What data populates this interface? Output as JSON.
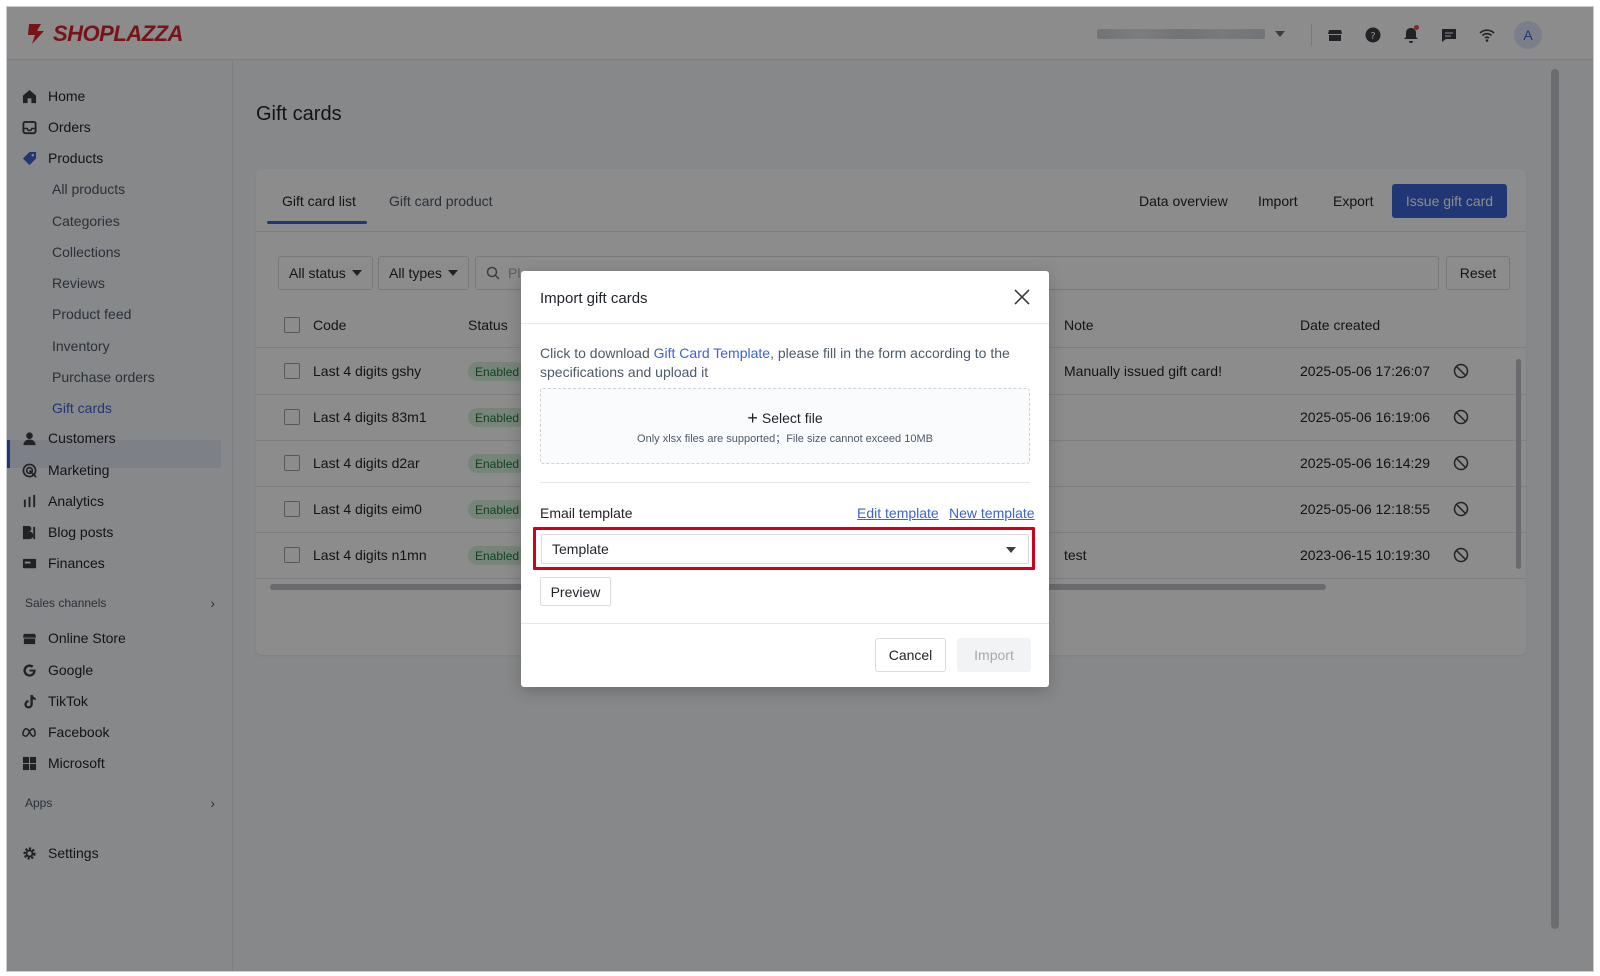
{
  "brand": {
    "name": "SHOPLAZZA",
    "color": "#d8262c"
  },
  "topbar": {
    "avatar_letter": "A",
    "icons": [
      "store-icon",
      "help-icon",
      "bell-icon",
      "message-icon",
      "wifi-icon"
    ]
  },
  "sidebar": {
    "items": [
      {
        "label": "Home",
        "icon": "home-icon"
      },
      {
        "label": "Orders",
        "icon": "orders-icon"
      },
      {
        "label": "Products",
        "icon": "tag-icon"
      },
      {
        "label": "Customers",
        "icon": "person-icon"
      },
      {
        "label": "Marketing",
        "icon": "marketing-icon"
      },
      {
        "label": "Analytics",
        "icon": "bar-chart-icon"
      },
      {
        "label": "Blog posts",
        "icon": "blog-icon"
      },
      {
        "label": "Finances",
        "icon": "finance-icon"
      }
    ],
    "product_subitems": [
      "All products",
      "Categories",
      "Collections",
      "Reviews",
      "Product feed",
      "Inventory",
      "Purchase orders",
      "Gift cards"
    ],
    "sales_channels_label": "Sales channels",
    "channels": [
      {
        "label": "Online Store",
        "icon": "store-icon"
      },
      {
        "label": "Google",
        "icon": "google-icon"
      },
      {
        "label": "TikTok",
        "icon": "tiktok-icon"
      },
      {
        "label": "Facebook",
        "icon": "meta-icon"
      },
      {
        "label": "Microsoft",
        "icon": "microsoft-icon"
      }
    ],
    "apps_label": "Apps",
    "settings_label": "Settings"
  },
  "page": {
    "title": "Gift cards",
    "tabs": [
      "Gift card list",
      "Gift card product"
    ],
    "actions": {
      "data_overview": "Data overview",
      "import": "Import",
      "export": "Export",
      "issue": "Issue gift card"
    },
    "filters": {
      "status": "All status",
      "types": "All types",
      "search_placeholder": "Pl",
      "reset": "Reset"
    },
    "table": {
      "headers": {
        "code": "Code",
        "status": "Status",
        "note": "Note",
        "date_created": "Date created"
      },
      "rows": [
        {
          "code": "Last 4 digits gshy",
          "status": "Enabled",
          "note": "Manually issued gift card!",
          "date": "2025-05-06 17:26:07"
        },
        {
          "code": "Last 4 digits 83m1",
          "status": "Enabled",
          "note": "",
          "date": "2025-05-06 16:19:06"
        },
        {
          "code": "Last 4 digits d2ar",
          "status": "Enabled",
          "note": "",
          "date": "2025-05-06 16:14:29"
        },
        {
          "code": "Last 4 digits eim0",
          "status": "Enabled",
          "note": "",
          "date": "2025-05-06 12:18:55"
        },
        {
          "code": "Last 4 digits n1mn",
          "status": "Enabled",
          "note": "test",
          "date": "2023-06-15 10:19:30"
        }
      ]
    }
  },
  "modal": {
    "title": "Import gift cards",
    "desc_prefix": "Click to download ",
    "desc_link": "Gift Card Template",
    "desc_suffix": ", please fill in the form according to the specifications and upload it",
    "select_file": "Select file",
    "file_hint": "Only xlsx files are supported；File size cannot exceed 10MB",
    "email_template_label": "Email template",
    "edit_template": "Edit template",
    "new_template": "New template",
    "template_value": "Template",
    "preview": "Preview",
    "cancel": "Cancel",
    "import": "Import"
  },
  "colors": {
    "accent": "#3c63d6",
    "highlight": "#d0021b",
    "enabled_bg": "#d7f0dd"
  }
}
